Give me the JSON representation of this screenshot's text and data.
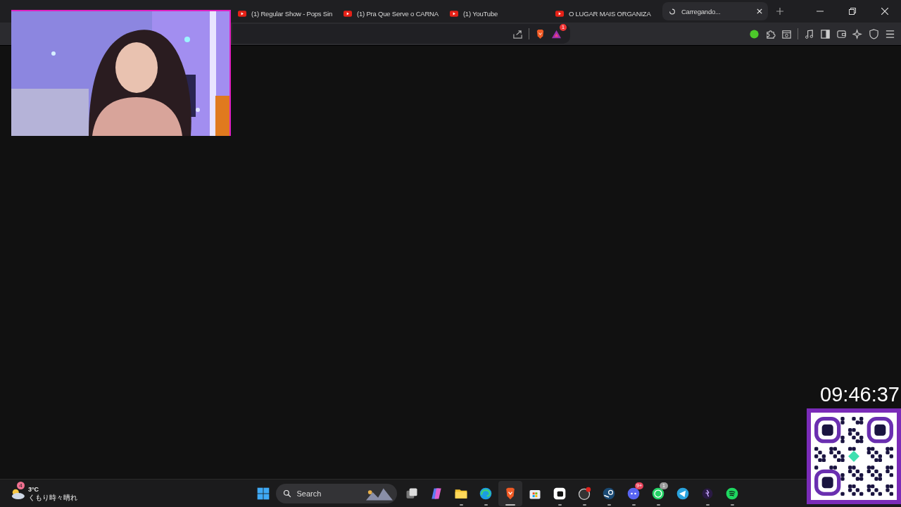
{
  "tabs": [
    {
      "kind": "youtube",
      "title": "(1) Regular Show - Pops Sin",
      "selected": false
    },
    {
      "kind": "youtube",
      "title": "(1) Pra Que Serve o CARNA",
      "selected": false
    },
    {
      "kind": "youtube",
      "title": "(1) YouTube",
      "selected": false
    },
    {
      "kind": "youtube",
      "title": "O LUGAR MAIS ORGANIZA",
      "selected": false
    },
    {
      "kind": "loading",
      "title": "Carregando...",
      "selected": true
    }
  ],
  "toolbar": {
    "rewards_badge": "1"
  },
  "overlay": {
    "clock": "09:46:37"
  },
  "taskbar": {
    "weather": {
      "temperature": "3°C",
      "condition": "くもり時々晴れ",
      "badge": "4"
    },
    "search": {
      "placeholder": "Search"
    },
    "apps": [
      {
        "kind": "start",
        "running": false,
        "selected": false
      },
      {
        "kind": "task-view",
        "running": false,
        "selected": false
      },
      {
        "kind": "copilot",
        "running": false,
        "selected": false
      },
      {
        "kind": "folder",
        "running": true,
        "selected": false
      },
      {
        "kind": "edge",
        "running": true,
        "selected": false
      },
      {
        "kind": "brave",
        "running": true,
        "selected": true
      },
      {
        "kind": "store",
        "running": false,
        "selected": false
      },
      {
        "kind": "streamlabs",
        "running": true,
        "selected": false
      },
      {
        "kind": "obs",
        "running": true,
        "selected": false
      },
      {
        "kind": "steam",
        "running": true,
        "selected": false
      },
      {
        "kind": "discord",
        "running": true,
        "selected": false,
        "badge": "9+"
      },
      {
        "kind": "whatsapp",
        "running": true,
        "selected": false,
        "badge": "1"
      },
      {
        "kind": "telegram",
        "running": false,
        "selected": false
      },
      {
        "kind": "runner",
        "running": true,
        "selected": false
      },
      {
        "kind": "spotify",
        "running": true,
        "selected": false
      }
    ]
  }
}
